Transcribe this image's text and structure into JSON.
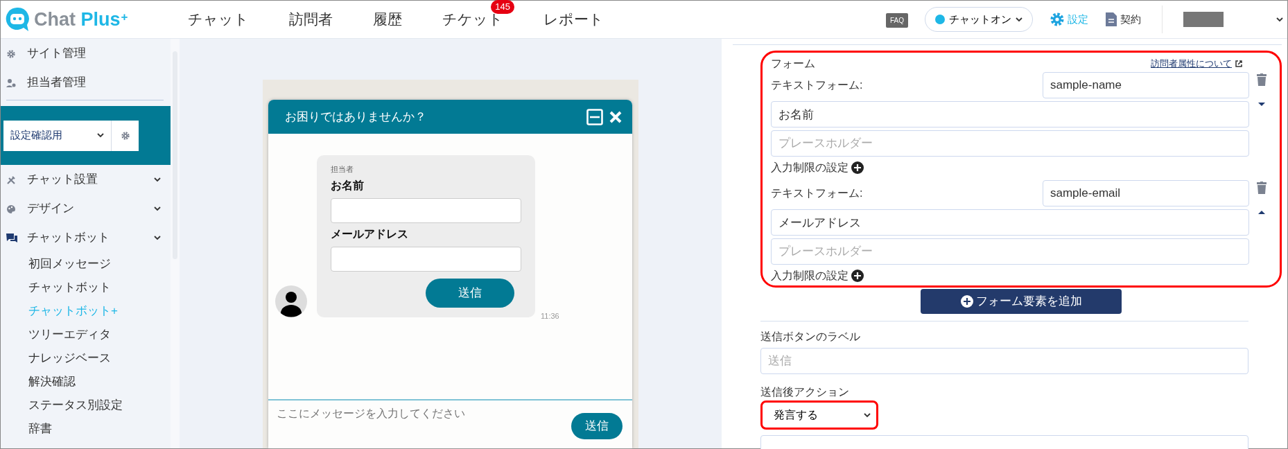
{
  "header": {
    "logo": {
      "text": "Chat Plus",
      "sup": "+"
    },
    "nav": [
      {
        "label": "チャット"
      },
      {
        "label": "訪問者"
      },
      {
        "label": "履歴"
      },
      {
        "label": "チケット",
        "badge": "145"
      },
      {
        "label": "レポート"
      }
    ],
    "faq": "FAQ",
    "chat_toggle": {
      "label": "チャットオン",
      "on": true
    },
    "settings": "設定",
    "contract": "契約"
  },
  "sidebar": {
    "top_items": [
      {
        "label": "サイト管理",
        "kind": "gear"
      },
      {
        "label": "担当者管理",
        "kind": "user"
      }
    ],
    "site_select": "設定確認用",
    "sections": [
      {
        "label": "チャット設置",
        "kind": "tools"
      },
      {
        "label": "デザイン",
        "kind": "palette"
      },
      {
        "label": "チャットボット",
        "kind": "chat",
        "children": [
          {
            "label": "初回メッセージ",
            "selected": false
          },
          {
            "label": "チャットボット",
            "selected": false
          },
          {
            "label": "チャットボット+",
            "selected": true
          },
          {
            "label": "ツリーエディタ",
            "selected": false
          },
          {
            "label": "ナレッジベース",
            "selected": false
          },
          {
            "label": "解決確認",
            "selected": false
          },
          {
            "label": "ステータス別設定",
            "selected": false
          },
          {
            "label": "辞書",
            "selected": false
          }
        ]
      }
    ]
  },
  "preview": {
    "title": "お困りではありませんか？",
    "agent": "担当者",
    "fields": [
      {
        "label": "お名前"
      },
      {
        "label": "メールアドレス"
      }
    ],
    "submit": "送信",
    "time": "11:36",
    "input_placeholder": "ここにメッセージを入力してください",
    "send": "送信"
  },
  "form_panel": {
    "highlighted": true,
    "title": "フォーム",
    "help_link": "訪問者属性について",
    "elements": [
      {
        "type_label": "テキストフォーム:",
        "key": "sample-name",
        "label": "お名前",
        "placeholder": "プレースホルダー",
        "restriction": "入力制限の設定",
        "caret_down": true
      },
      {
        "type_label": "テキストフォーム:",
        "key": "sample-email",
        "label": "メールアドレス",
        "placeholder": "プレースホルダー",
        "restriction": "入力制限の設定",
        "caret_down": false
      }
    ],
    "add_button": "フォーム要素を追加",
    "submit_label": {
      "label": "送信ボタンのラベル",
      "placeholder": "送信"
    },
    "after_action": {
      "label": "送信後アクション",
      "value": "発言する",
      "highlighted": true
    }
  }
}
